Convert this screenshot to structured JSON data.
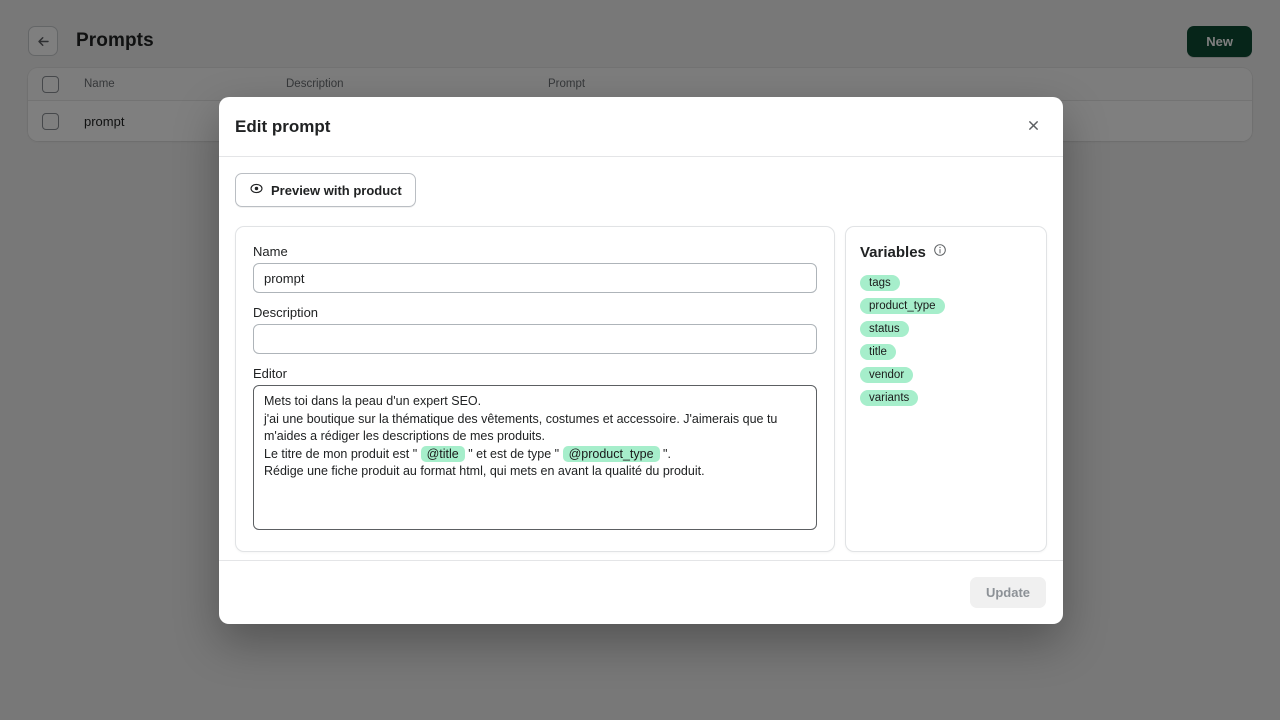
{
  "page": {
    "title": "Prompts",
    "back_icon": "arrow-left-icon",
    "new_button": "New",
    "accent_green": "#0d4a33"
  },
  "table": {
    "columns": [
      "Name",
      "Description",
      "Prompt"
    ],
    "rows": [
      {
        "name": "prompt",
        "description": "",
        "prompt": ""
      }
    ]
  },
  "modal": {
    "title": "Edit prompt",
    "close_icon": "close-icon",
    "preview_button": {
      "label": "Preview with product",
      "icon": "eye-icon"
    },
    "form": {
      "name_label": "Name",
      "name_value": "prompt",
      "name_placeholder": "",
      "description_label": "Description",
      "description_value": "",
      "description_placeholder": "",
      "editor_label": "Editor",
      "editor_lines": [
        {
          "type": "text",
          "text": "Mets toi dans la peau d'un expert SEO."
        },
        {
          "type": "text",
          "text": "j'ai une boutique sur la thématique des vêtements, costumes et accessoire. J'aimerais que tu m'aides a rédiger les descriptions de mes produits."
        },
        {
          "type": "rich",
          "parts": [
            {
              "kind": "text",
              "text": "Le titre de mon produit est \" "
            },
            {
              "kind": "token",
              "text": "@title"
            },
            {
              "kind": "text",
              "text": " \" et est de type \" "
            },
            {
              "kind": "token",
              "text": "@product_type"
            },
            {
              "kind": "text",
              "text": " \"."
            }
          ]
        },
        {
          "type": "text",
          "text": "Rédige une fiche produit au format html, qui mets en avant la qualité du produit."
        }
      ]
    },
    "variables": {
      "title": "Variables",
      "info_icon": "info-circle-icon",
      "pill_color": "#a6eecb",
      "items": [
        "tags",
        "product_type",
        "status",
        "title",
        "vendor",
        "variants"
      ]
    },
    "footer": {
      "update_label": "Update",
      "update_disabled": true
    }
  }
}
